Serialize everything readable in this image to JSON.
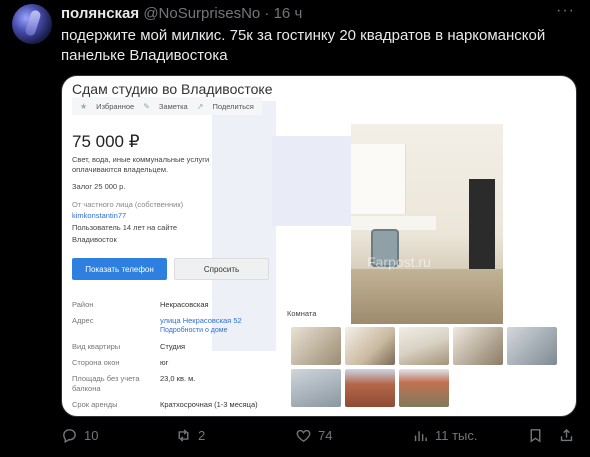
{
  "tweet": {
    "author_name": "полянская",
    "handle": "@NoSurprisesNo",
    "separator": "·",
    "time": "16 ч",
    "text": "подержите мой милкис. 75к за гостинку 20 квадратов в наркоманской панельке Владивостока"
  },
  "listing": {
    "title": "Сдам студию во Владивостоке",
    "actions": [
      "Избранное",
      "Заметка",
      "Поделиться"
    ],
    "price": "75 000 ₽",
    "utilities_note": "Свет, вода, иные коммунальные услуги оплачиваются владельцем.",
    "deposit": "Залог 25 000 р.",
    "owner_type": "От частного лица (собственник)",
    "owner_name": "kimkonstantin77",
    "owner_since": "Пользователь 14 лет на сайте",
    "owner_city": "Владивосток",
    "btn_phone": "Показать телефон",
    "btn_ask": "Спросить",
    "watermark": "Farpost.ru",
    "photo_caption": "Комната",
    "params": [
      {
        "key": "Район",
        "value": "Некрасовская"
      },
      {
        "key": "Адрес",
        "value": "улица Некрасовская 52",
        "extra": "Подробности о доме"
      },
      {
        "key": "Вид квартиры",
        "value": "Студия"
      },
      {
        "key": "Сторона окон",
        "value": "юг"
      },
      {
        "key": "Площадь без учета балкона",
        "value": "23,0 кв. м."
      },
      {
        "key": "Срок аренды",
        "value": "Кратхосрочная (1-3 месяца)"
      }
    ]
  },
  "stats": {
    "replies": "10",
    "reposts": "2",
    "likes": "74",
    "views": "11 тыс."
  },
  "colors": {
    "accent_blue": "#2d7fe0",
    "muted": "#71767b",
    "text": "#e7e9ea"
  }
}
